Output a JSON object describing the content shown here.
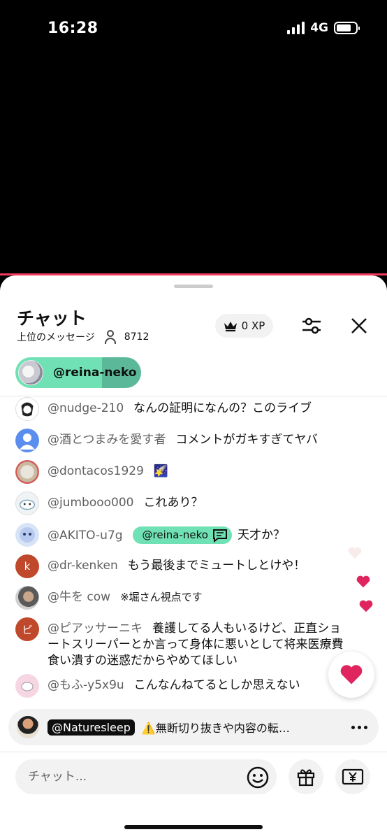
{
  "status_bar": {
    "time": "16:28",
    "network": "4G",
    "battery_level": 0.75
  },
  "chat_header": {
    "title": "チャット",
    "sort_label": "上位のメッセージ",
    "viewer_count": "8712",
    "xp_label": "0 XP",
    "icons": {
      "crown": "crown-icon",
      "viewers": "person-icon",
      "filter": "sliders-icon",
      "close": "close-icon"
    }
  },
  "pinned": {
    "name": "@reina-neko"
  },
  "messages": [
    {
      "author": "@nudge-210",
      "text": "なんの証明になんの？このライブ",
      "avatar_color": "#ffffff"
    },
    {
      "author": "@酒とつまみを愛す者",
      "text": "コメントがガキすぎてヤバ",
      "avatar_color": "#5b8def"
    },
    {
      "author": "@dontacos1929",
      "text": "🌠",
      "avatar_color": "#e9e5dc"
    },
    {
      "author": "@jumbooo000",
      "text": "これあり？",
      "avatar_color": "#f0f3f5"
    },
    {
      "author": "@AKITO-u7g",
      "mention": "@reina-neko",
      "text": "天才か？",
      "avatar_color": "#d6e4f5"
    },
    {
      "author": "@dr-kenken",
      "text": "もう最後までミュートしとけや！",
      "avatar_initial": "k",
      "avatar_color": "#c0482b"
    },
    {
      "author": "@牛を cow",
      "text": "※堀さん視点です",
      "avatar_color": "#8a8a8a"
    },
    {
      "author": "@ピアッサーニキ",
      "text_lines": [
        "養護してる人もいるけど、正直ショ",
        "ートスリーパーとか言って身体に悪いとして将来医療費",
        "食い潰すの迷惑だからやめてほしい"
      ],
      "avatar_initial": "ピ",
      "avatar_color": "#c0482b"
    },
    {
      "author": "@もふ-y5x9u",
      "text": "こんなんねてるとしか思えない",
      "avatar_color": "#f6d6e2"
    }
  ],
  "ticker": {
    "name": "@Naturesleep",
    "text": "⚠️無断切り抜きや内容の転…"
  },
  "composer": {
    "placeholder": "チャット...",
    "icons": {
      "emoji": "smiley-icon",
      "gift": "gift-icon",
      "super_chat": "yen-icon"
    }
  },
  "colors": {
    "accent_mint": "#6fe1b4",
    "heart_red": "#e0245e",
    "progress": "#f23b5d"
  }
}
